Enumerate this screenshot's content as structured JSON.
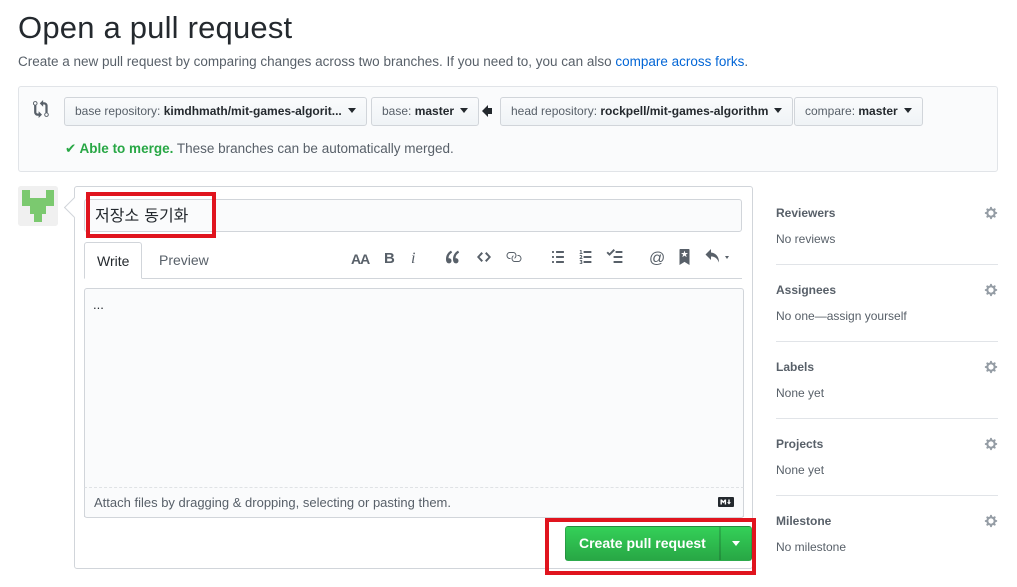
{
  "page": {
    "title": "Open a pull request",
    "subtitle_text": "Create a new pull request by comparing changes across two branches. If you need to, you can also ",
    "subtitle_link": "compare across forks",
    "subtitle_end": "."
  },
  "range": {
    "base_repo_label": "base repository: ",
    "base_repo_value": "kimdhmath/mit-games-algorit...",
    "base_label": "base: ",
    "base_value": "master",
    "head_repo_label": "head repository: ",
    "head_repo_value": "rockpell/mit-games-algorithm",
    "compare_label": "compare: ",
    "compare_value": "master",
    "merge_ok": "✔ Able to merge.",
    "merge_text": " These branches can be automatically merged."
  },
  "form": {
    "title_value": "저장소 동기화",
    "tab_write": "Write",
    "tab_preview": "Preview",
    "toolbar": {
      "heading": "AA",
      "bold": "B",
      "italic": "i"
    },
    "body_value": "...",
    "attach_text": "Attach files by dragging & dropping, selecting or pasting them.",
    "submit_label": "Create pull request"
  },
  "sidebar": {
    "sections": [
      {
        "title": "Reviewers",
        "value": "No reviews"
      },
      {
        "title": "Assignees",
        "value": "No one—assign yourself"
      },
      {
        "title": "Labels",
        "value": "None yet"
      },
      {
        "title": "Projects",
        "value": "None yet"
      },
      {
        "title": "Milestone",
        "value": "No milestone"
      }
    ]
  },
  "colors": {
    "accent_link": "#0366d6",
    "success": "#28a745",
    "highlight_box": "#e0141e"
  }
}
